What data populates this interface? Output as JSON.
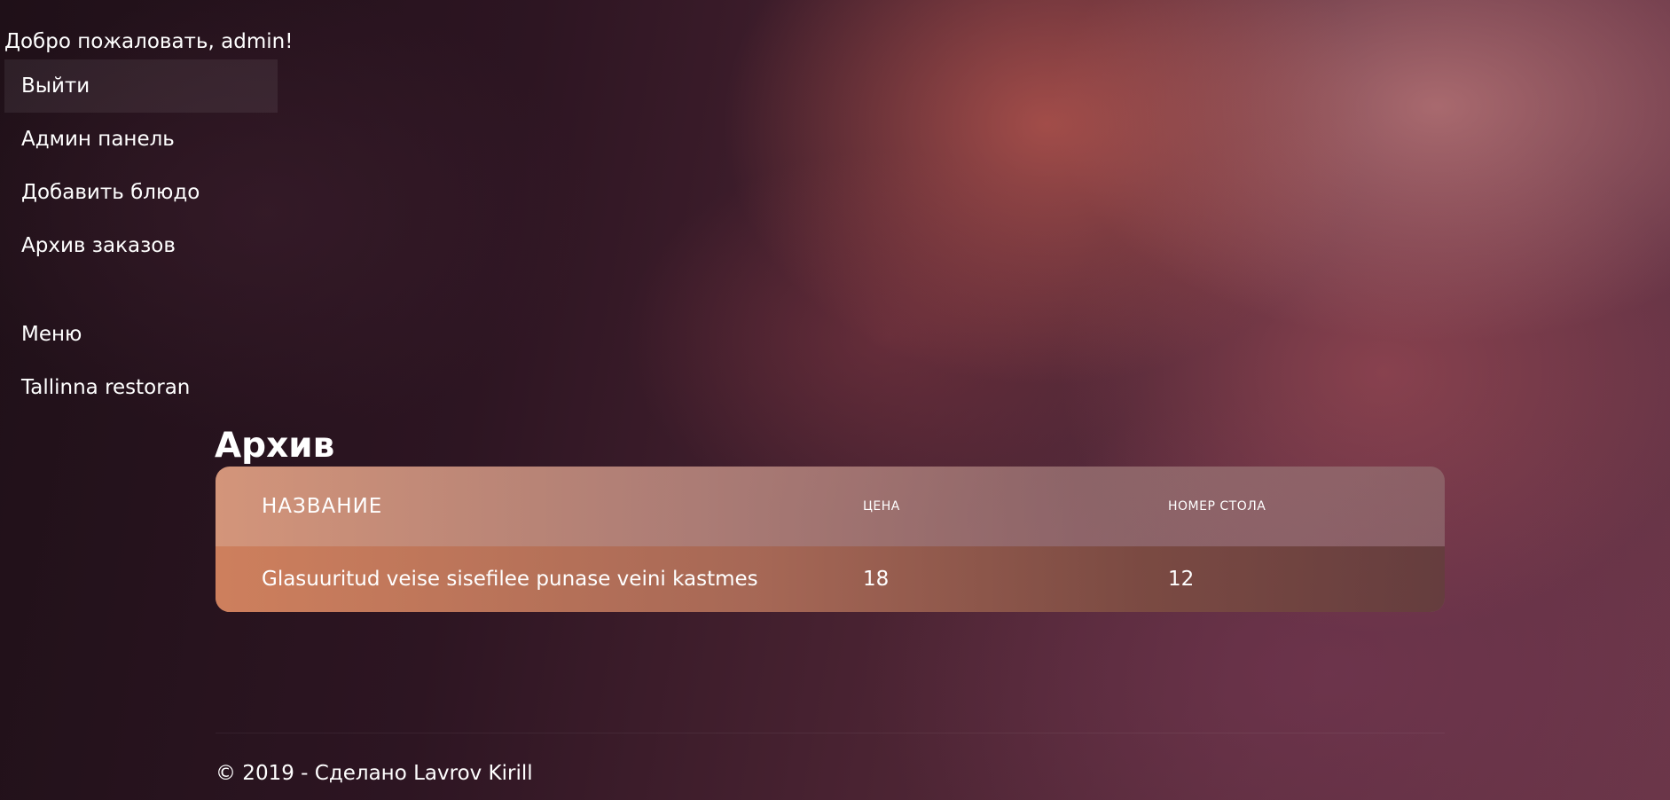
{
  "header": {
    "welcome": "Добро пожаловать, admin!"
  },
  "nav": {
    "logout": "Выйти",
    "admin_panel": "Админ панель",
    "add_dish": "Добавить блюдо",
    "orders_archive": "Архив заказов",
    "menu": "Меню",
    "restaurant": "Tallinna restoran"
  },
  "main": {
    "title": "Архив",
    "table": {
      "columns": [
        "НАЗВАНИЕ",
        "ЦЕНА",
        "НОМЕР СТОЛА"
      ],
      "rows": [
        [
          "Glasuuritud veise sisefilee punase veini kastmes",
          "18",
          "12"
        ]
      ]
    }
  },
  "footer": {
    "text": "© 2019 - Сделано Lavrov Kirill"
  },
  "colors": {
    "background_dark": "#2a1522",
    "table_header_start": "#e2a082",
    "table_row_start": "#cd7d5a",
    "text": "#ffffff"
  }
}
